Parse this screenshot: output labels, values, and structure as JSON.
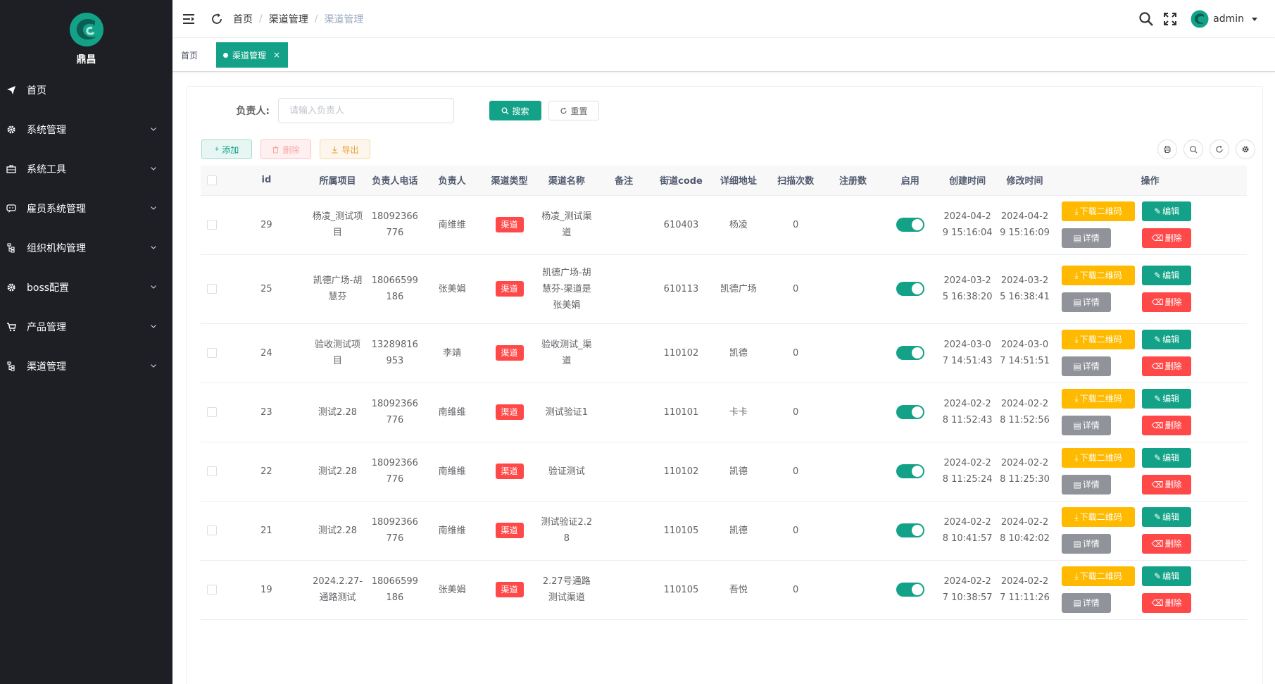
{
  "brand": {
    "name": "鼎昌"
  },
  "sidebar": {
    "items": [
      {
        "label": "首页",
        "icon": "send-icon",
        "expandable": false
      },
      {
        "label": "系统管理",
        "icon": "gear-icon",
        "expandable": true
      },
      {
        "label": "系统工具",
        "icon": "toolbox-icon",
        "expandable": true
      },
      {
        "label": "雇员系统管理",
        "icon": "chat-icon",
        "expandable": true
      },
      {
        "label": "组织机构管理",
        "icon": "tree-icon",
        "expandable": true
      },
      {
        "label": "boss配置",
        "icon": "gear-icon",
        "expandable": true
      },
      {
        "label": "产品管理",
        "icon": "cart-icon",
        "expandable": true
      },
      {
        "label": "渠道管理",
        "icon": "tree-icon",
        "expandable": true
      }
    ]
  },
  "header": {
    "breadcrumb": [
      "首页",
      "渠道管理",
      "渠道管理"
    ],
    "breadcrumb_sep": "/",
    "user": "admin"
  },
  "tags": {
    "home": "首页",
    "active": "渠道管理",
    "close": "×"
  },
  "search": {
    "label": "负责人:",
    "placeholder": "请输入负责人",
    "search_btn": "搜索",
    "reset_btn": "重置"
  },
  "toolbar": {
    "add": "添加",
    "delete": "删除",
    "export": "导出"
  },
  "table": {
    "columns": [
      "id",
      "所属项目",
      "负责人电话",
      "负责人",
      "渠道类型",
      "渠道名称",
      "备注",
      "街道code",
      "详细地址",
      "扫描次数",
      "注册数",
      "启用",
      "创建时间",
      "修改时间",
      "操作"
    ],
    "row_actions": {
      "download": "下载二维码",
      "edit": "编辑",
      "detail": "详情",
      "delete": "删除"
    },
    "rows": [
      {
        "id": "29",
        "project": "杨凌_测试项目",
        "phone": "18092366776",
        "owner": "南维维",
        "type": "渠道",
        "name": "杨凌_测试渠道",
        "remark": "",
        "code": "610403",
        "address": "杨凌",
        "scans": "0",
        "regs": "",
        "enabled": true,
        "created": "2024-04-29 15:16:04",
        "modified": "2024-04-29 15:16:09"
      },
      {
        "id": "25",
        "project": "凯德广场-胡慧芬",
        "phone": "18066599186",
        "owner": "张美娟",
        "type": "渠道",
        "name": "凯德广场-胡慧芬-渠道是张美娟",
        "remark": "",
        "code": "610113",
        "address": "凯德广场",
        "scans": "0",
        "regs": "",
        "enabled": true,
        "created": "2024-03-25 16:38:20",
        "modified": "2024-03-25 16:38:41"
      },
      {
        "id": "24",
        "project": "验收测试项目",
        "phone": "13289816953",
        "owner": "李靖",
        "type": "渠道",
        "name": "验收测试_渠道",
        "remark": "",
        "code": "110102",
        "address": "凯德",
        "scans": "0",
        "regs": "",
        "enabled": true,
        "created": "2024-03-07 14:51:43",
        "modified": "2024-03-07 14:51:51"
      },
      {
        "id": "23",
        "project": "测试2.28",
        "phone": "18092366776",
        "owner": "南维维",
        "type": "渠道",
        "name": "测试验证1",
        "remark": "",
        "code": "110101",
        "address": "卡卡",
        "scans": "0",
        "regs": "",
        "enabled": true,
        "created": "2024-02-28 11:52:43",
        "modified": "2024-02-28 11:52:56"
      },
      {
        "id": "22",
        "project": "测试2.28",
        "phone": "18092366776",
        "owner": "南维维",
        "type": "渠道",
        "name": "验证测试",
        "remark": "",
        "code": "110102",
        "address": "凯德",
        "scans": "0",
        "regs": "",
        "enabled": true,
        "created": "2024-02-28 11:25:24",
        "modified": "2024-02-28 11:25:30"
      },
      {
        "id": "21",
        "project": "测试2.28",
        "phone": "18092366776",
        "owner": "南维维",
        "type": "渠道",
        "name": "测试验证2.28",
        "remark": "",
        "code": "110105",
        "address": "凯德",
        "scans": "0",
        "regs": "",
        "enabled": true,
        "created": "2024-02-28 10:41:57",
        "modified": "2024-02-28 10:42:02"
      },
      {
        "id": "19",
        "project": "2024.2.27-通路测试",
        "phone": "18066599186",
        "owner": "张美娟",
        "type": "渠道",
        "name": "2.27号通路测试渠道",
        "remark": "",
        "code": "110105",
        "address": "吾悦",
        "scans": "0",
        "regs": "",
        "enabled": true,
        "created": "2024-02-27 10:38:57",
        "modified": "2024-02-27 11:11:26"
      }
    ]
  },
  "colors": {
    "primary": "#13a287",
    "danger": "#ff4949",
    "warning": "#ffba00",
    "info": "#909399",
    "sidebar_bg": "#1d1f25"
  }
}
